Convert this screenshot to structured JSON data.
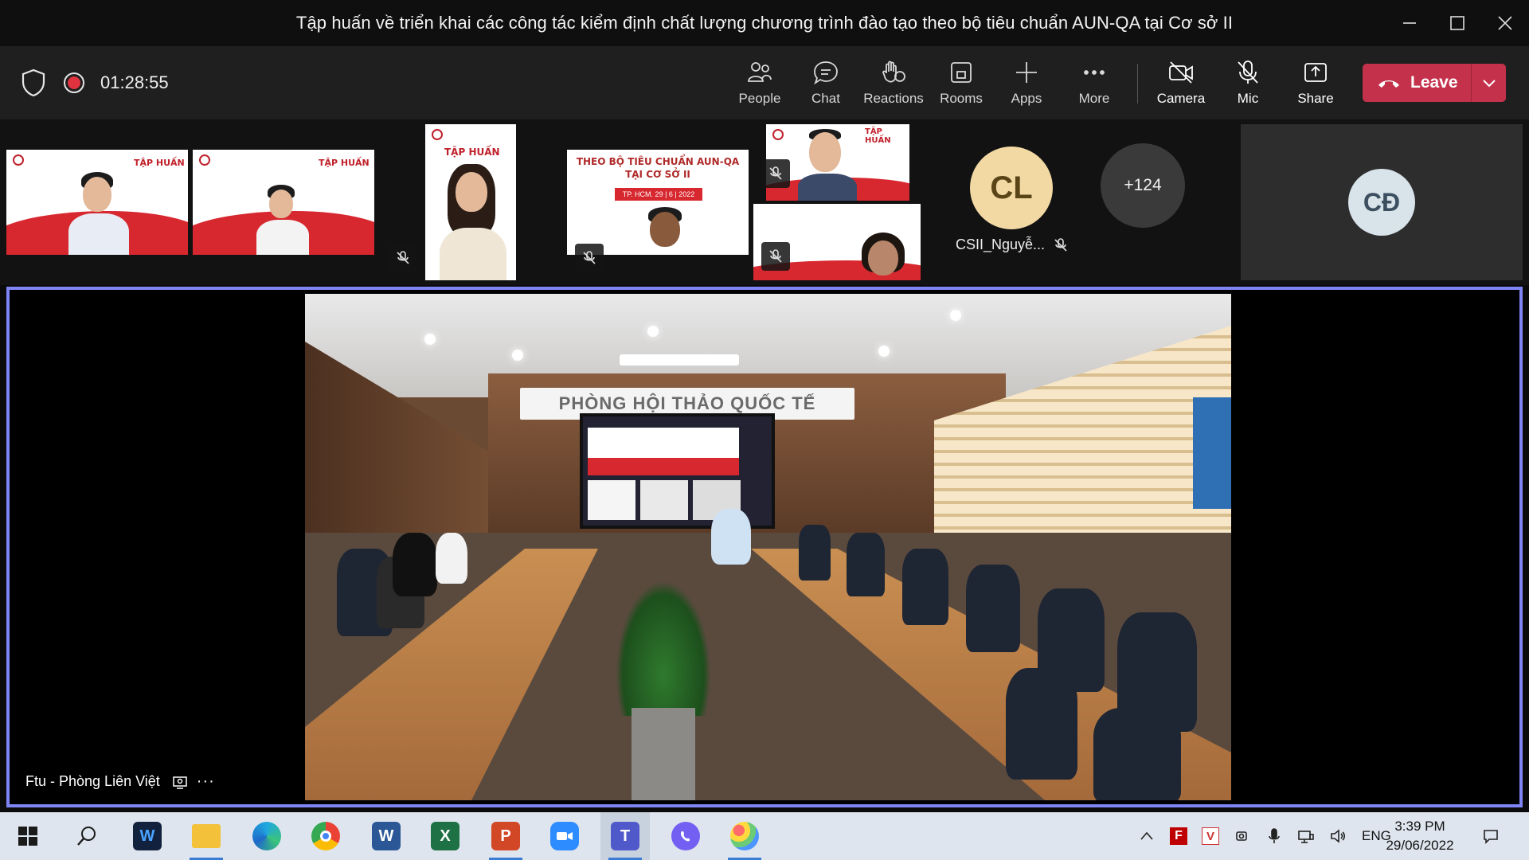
{
  "window": {
    "title": "Tập huấn về triển khai các công tác kiểm định chất lượng chương trình đào tạo theo bộ tiêu chuẩn AUN-QA tại Cơ sở II"
  },
  "toolbar": {
    "timer": "01:28:55",
    "buttons": [
      {
        "label": "People",
        "icon": "people-icon"
      },
      {
        "label": "Chat",
        "icon": "chat-icon"
      },
      {
        "label": "Reactions",
        "icon": "reactions-icon"
      },
      {
        "label": "Rooms",
        "icon": "rooms-icon"
      },
      {
        "label": "Apps",
        "icon": "plus-icon"
      },
      {
        "label": "More",
        "icon": "more-icon"
      },
      {
        "label": "Camera",
        "icon": "camera-off-icon"
      },
      {
        "label": "Mic",
        "icon": "mic-off-icon"
      },
      {
        "label": "Share",
        "icon": "share-icon"
      }
    ],
    "leave_label": "Leave",
    "colors": {
      "leave": "#c4314b",
      "stage_border": "#7f85f5"
    }
  },
  "gallery": {
    "slide_heading": "TẬP HUẤN",
    "slide_text": "THEO BỘ TIÊU CHUẨN AUN-QA",
    "slide_text2": "TẠI CƠ SỞ II",
    "slide_date": "TP. HCM. 29 | 6 | 2022",
    "cl_initials": "CL",
    "cl_name": "CSII_Nguyễ...",
    "overflow_count": "+124",
    "cd_initials": "CĐ"
  },
  "stage": {
    "participant_name": "Ftu - Phòng Liên Việt",
    "room_sign": "PHÒNG HỘI THẢO QUỐC TẾ",
    "more": "···"
  },
  "taskbar": {
    "apps": [
      {
        "name": "start",
        "icon": "windows-icon"
      },
      {
        "name": "search",
        "icon": "search-icon"
      },
      {
        "name": "wavepad",
        "icon": "wavepad-icon"
      },
      {
        "name": "file-explorer",
        "icon": "folder-icon"
      },
      {
        "name": "edge",
        "icon": "edge-icon"
      },
      {
        "name": "chrome",
        "icon": "chrome-icon"
      },
      {
        "name": "word",
        "icon": "word-icon"
      },
      {
        "name": "excel",
        "icon": "excel-icon"
      },
      {
        "name": "powerpoint",
        "icon": "powerpoint-icon"
      },
      {
        "name": "zoom",
        "icon": "zoom-icon"
      },
      {
        "name": "teams",
        "icon": "teams-icon"
      },
      {
        "name": "viber",
        "icon": "viber-icon"
      },
      {
        "name": "paint",
        "icon": "paint-icon"
      }
    ],
    "language": "ENG",
    "time": "3:39 PM",
    "date": "29/06/2022"
  }
}
